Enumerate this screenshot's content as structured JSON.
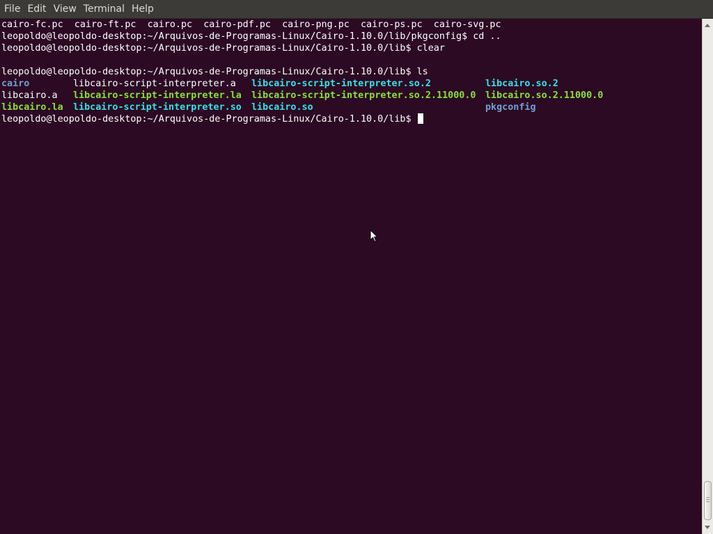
{
  "menubar": {
    "items": [
      "File",
      "Edit",
      "View",
      "Terminal",
      "Help"
    ]
  },
  "terminal": {
    "line_pc_files": "cairo-fc.pc  cairo-ft.pc  cairo.pc  cairo-pdf.pc  cairo-png.pc  cairo-ps.pc  cairo-svg.pc",
    "line_cd": "leopoldo@leopoldo-desktop:~/Arquivos-de-Programas-Linux/Cairo-1.10.0/lib/pkgconfig$ cd ..",
    "line_clear": "leopoldo@leopoldo-desktop:~/Arquivos-de-Programas-Linux/Cairo-1.10.0/lib$ clear",
    "line_ls": "leopoldo@leopoldo-desktop:~/Arquivos-de-Programas-Linux/Cairo-1.10.0/lib$ ls",
    "ls_output": {
      "row1": [
        "cairo",
        "libcairo-script-interpreter.a",
        "libcairo-script-interpreter.so.2",
        "libcairo.so.2"
      ],
      "row2": [
        "libcairo.a",
        "libcairo-script-interpreter.la",
        "libcairo-script-interpreter.so.2.11000.0",
        "libcairo.so.2.11000.0"
      ],
      "row3": [
        "libcairo.la",
        "libcairo-script-interpreter.so",
        "libcairo.so",
        "pkgconfig"
      ]
    },
    "prompt": "leopoldo@leopoldo-desktop:~/Arquivos-de-Programas-Linux/Cairo-1.10.0/lib$ "
  },
  "colors": {
    "background": "#2c0a24",
    "text": "#ffffff",
    "directory": "#729fcf",
    "symlink": "#34e2e2",
    "executable": "#8ae234"
  }
}
